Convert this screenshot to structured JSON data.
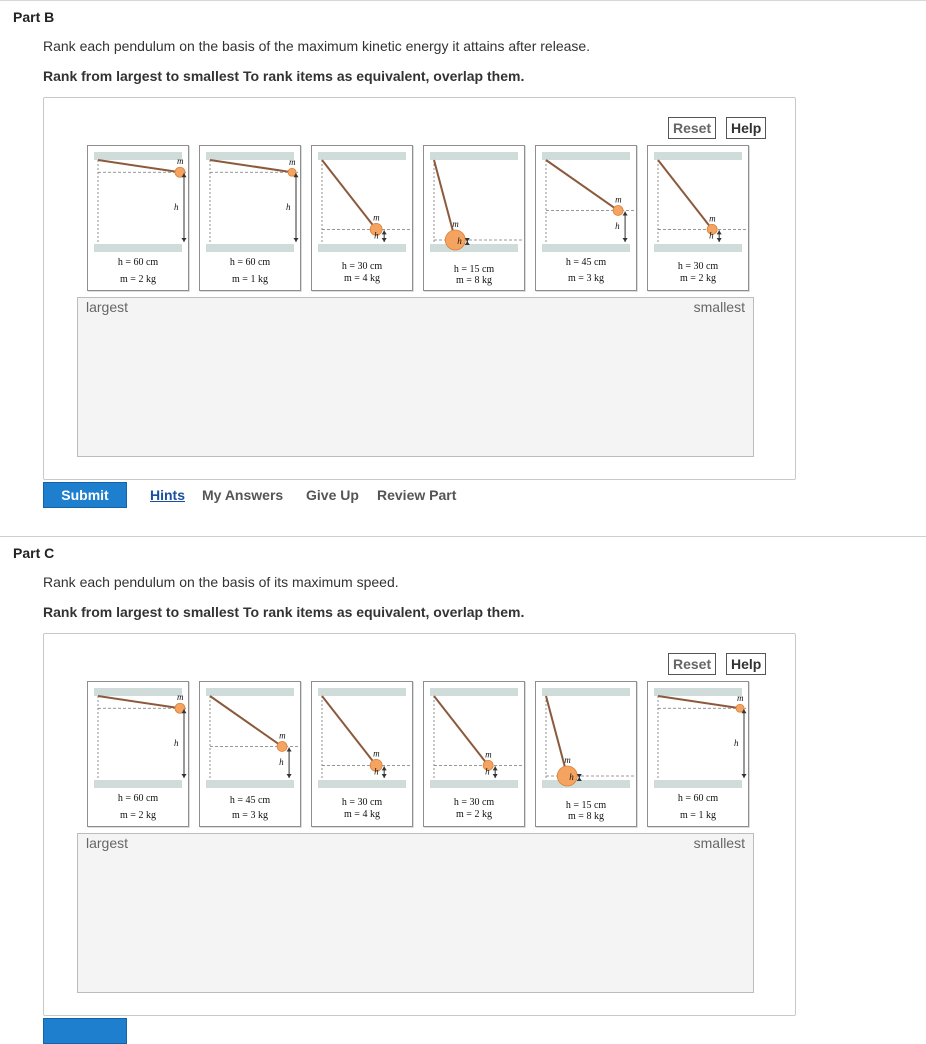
{
  "partB": {
    "title": "Part B",
    "question": "Rank each pendulum on the basis of the maximum kinetic energy it attains after release.",
    "instruction": "Rank from largest to smallest To rank items as equivalent, overlap them.",
    "reset_label": "Reset",
    "help_label": "Help",
    "largest_label": "largest",
    "smallest_label": "smallest",
    "cards": [
      {
        "h": "h = 60 cm",
        "m": "m = 2 kg"
      },
      {
        "h": "h = 60 cm",
        "m": "m = 1 kg"
      },
      {
        "h": "h = 30 cm",
        "m": "m = 4 kg"
      },
      {
        "h": "h = 15 cm",
        "m": "m = 8 kg"
      },
      {
        "h": "h = 45 cm",
        "m": "m = 3 kg"
      },
      {
        "h": "h = 30 cm",
        "m": "m = 2 kg"
      }
    ]
  },
  "actions": {
    "submit_label": "Submit",
    "hints_label": "Hints",
    "my_answers_label": "My Answers",
    "give_up_label": "Give Up",
    "review_part_label": "Review Part"
  },
  "partC": {
    "title": "Part C",
    "question": "Rank each pendulum on the basis of its maximum speed.",
    "instruction": "Rank from largest to smallest To rank items as equivalent, overlap them.",
    "reset_label": "Reset",
    "help_label": "Help",
    "largest_label": "largest",
    "smallest_label": "smallest",
    "cards": [
      {
        "h": "h = 60 cm",
        "m": "m = 2 kg"
      },
      {
        "h": "h = 45 cm",
        "m": "m = 3 kg"
      },
      {
        "h": "h = 30 cm",
        "m": "m = 4 kg"
      },
      {
        "h": "h = 30 cm",
        "m": "m = 2 kg"
      },
      {
        "h": "h = 15 cm",
        "m": "m = 8 kg"
      },
      {
        "h": "h = 60 cm",
        "m": "m = 1 kg"
      }
    ]
  },
  "diagram_labels": {
    "mass": "m",
    "height": "h"
  },
  "colors": {
    "accent": "#1f7fcf",
    "bob": "#f4a460",
    "string": "#8b5a3c",
    "ceiling": "#cfdcd9"
  }
}
